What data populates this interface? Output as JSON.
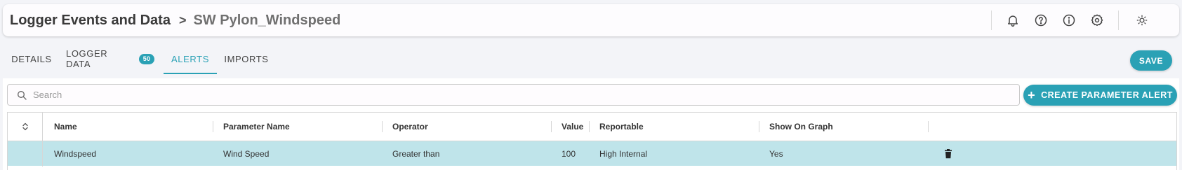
{
  "header": {
    "breadcrumb_root": "Logger Events and Data",
    "breadcrumb_separator": ">",
    "breadcrumb_current": "SW Pylon_Windspeed",
    "icons": [
      "bell-icon",
      "help-icon",
      "info-icon",
      "gear-icon",
      "theme-toggle-icon"
    ]
  },
  "tabs": [
    {
      "label": "DETAILS",
      "active": false
    },
    {
      "label": "LOGGER DATA",
      "badge": "50",
      "active": false
    },
    {
      "label": "ALERTS",
      "active": true
    },
    {
      "label": "IMPORTS",
      "active": false
    }
  ],
  "save_label": "SAVE",
  "search": {
    "placeholder": "Search",
    "value": ""
  },
  "create_alert_label": "CREATE PARAMETER ALERT",
  "table": {
    "columns": [
      "Name",
      "Parameter Name",
      "Operator",
      "Value",
      "Reportable",
      "Show On Graph"
    ],
    "rows": [
      {
        "name": "Windspeed",
        "parameter_name": "Wind Speed",
        "operator": "Greater than",
        "value": "100",
        "reportable": "High Internal",
        "show_on_graph": "Yes",
        "selected": true
      }
    ]
  },
  "colors": {
    "accent": "#2aa1b5",
    "selected_row": "#bfe4ea",
    "background": "#f3f4f8"
  }
}
